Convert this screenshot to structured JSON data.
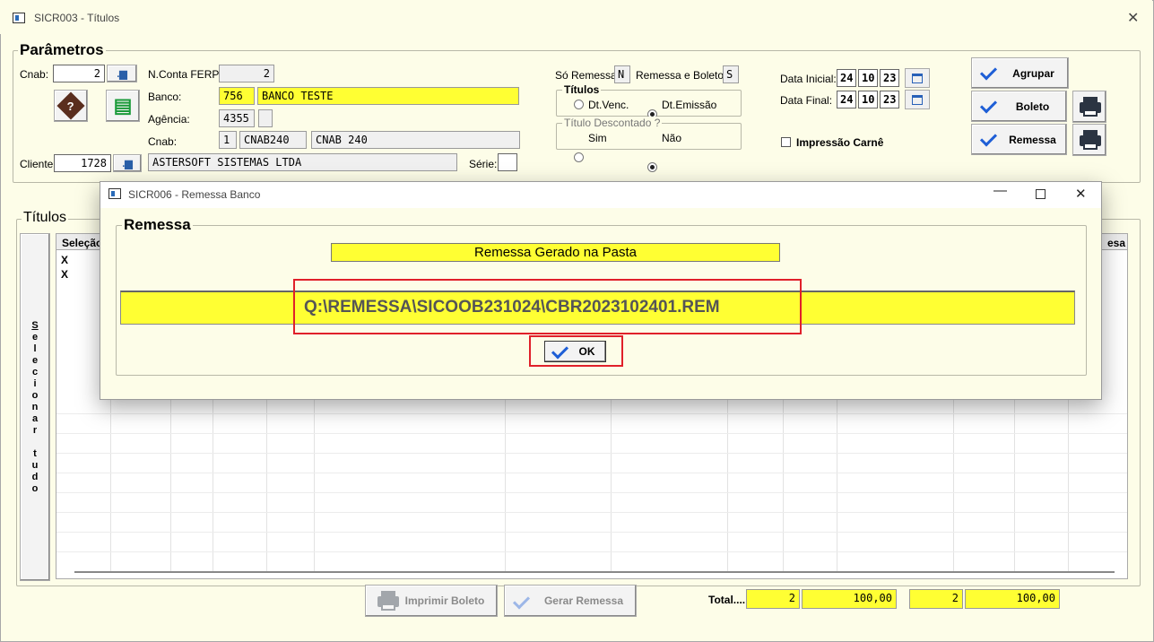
{
  "window": {
    "title": "SICR003 - Títulos"
  },
  "parametros": {
    "legend": "Parâmetros",
    "cnab_label": "Cnab:",
    "cnab_value": "2",
    "nconta_label": "N.Conta FERP:",
    "nconta_value": "2",
    "banco_label": "Banco:",
    "banco_code": "756",
    "banco_name": "BANCO TESTE",
    "agencia_label": "Agência:",
    "agencia_value": "4355",
    "agencia_dv": "",
    "cnab2_label": "Cnab:",
    "cnab2_code": "1",
    "cnab2_type": "CNAB240",
    "cnab2_desc": "CNAB 240",
    "cliente_label": "Cliente:",
    "cliente_value": "1728",
    "cliente_name": "ASTERSOFT SISTEMAS LTDA",
    "serie_label": "Série:",
    "serie_value": "",
    "so_remessa_label": "Só Remessa:",
    "so_remessa_value": "N",
    "remessa_boleto_label": "Remessa e Boleto:",
    "remessa_boleto_value": "S",
    "titulos_group": "Títulos",
    "dt_venc": "Dt.Venc.",
    "dt_emissao": "Dt.Emissão",
    "descontado_group": "Título Descontado ?",
    "sim": "Sim",
    "nao": "Não",
    "data_inicial_label": "Data Inicial:",
    "data_inicial": [
      "24",
      "10",
      "23"
    ],
    "data_final_label": "Data Final:",
    "data_final": [
      "24",
      "10",
      "23"
    ],
    "impressao_carne": "Impressão Carnê",
    "agrupar": "Agrupar",
    "boleto": "Boleto",
    "remessa": "Remessa"
  },
  "titulos": {
    "legend": "Títulos",
    "selecionar_tudo": [
      "S",
      "e",
      "l",
      "e",
      "c",
      "i",
      "o",
      "n",
      "a",
      "r",
      "",
      "t",
      "u",
      "d",
      "o"
    ],
    "col_selecao": "Seleção",
    "col_last": "esa",
    "rows": [
      "X",
      "X"
    ]
  },
  "footer": {
    "imprimir_boleto": "Imprimir Boleto",
    "gerar_remessa": "Gerar Remessa",
    "total_label": "Total....",
    "total_qtd1": "2",
    "total_val1": "100,00",
    "total_qtd2": "2",
    "total_val2": "100,00"
  },
  "modal": {
    "title": "SICR006 - Remessa Banco",
    "legend": "Remessa",
    "header": "Remessa Gerado na Pasta",
    "path": "Q:\\REMESSA\\SICOOB231024\\CBR2023102401.REM",
    "ok": "OK"
  },
  "colors": {
    "field_yellow": "#ffff33",
    "check_blue": "#1f5fd6",
    "highlight_red": "#e0202a"
  }
}
